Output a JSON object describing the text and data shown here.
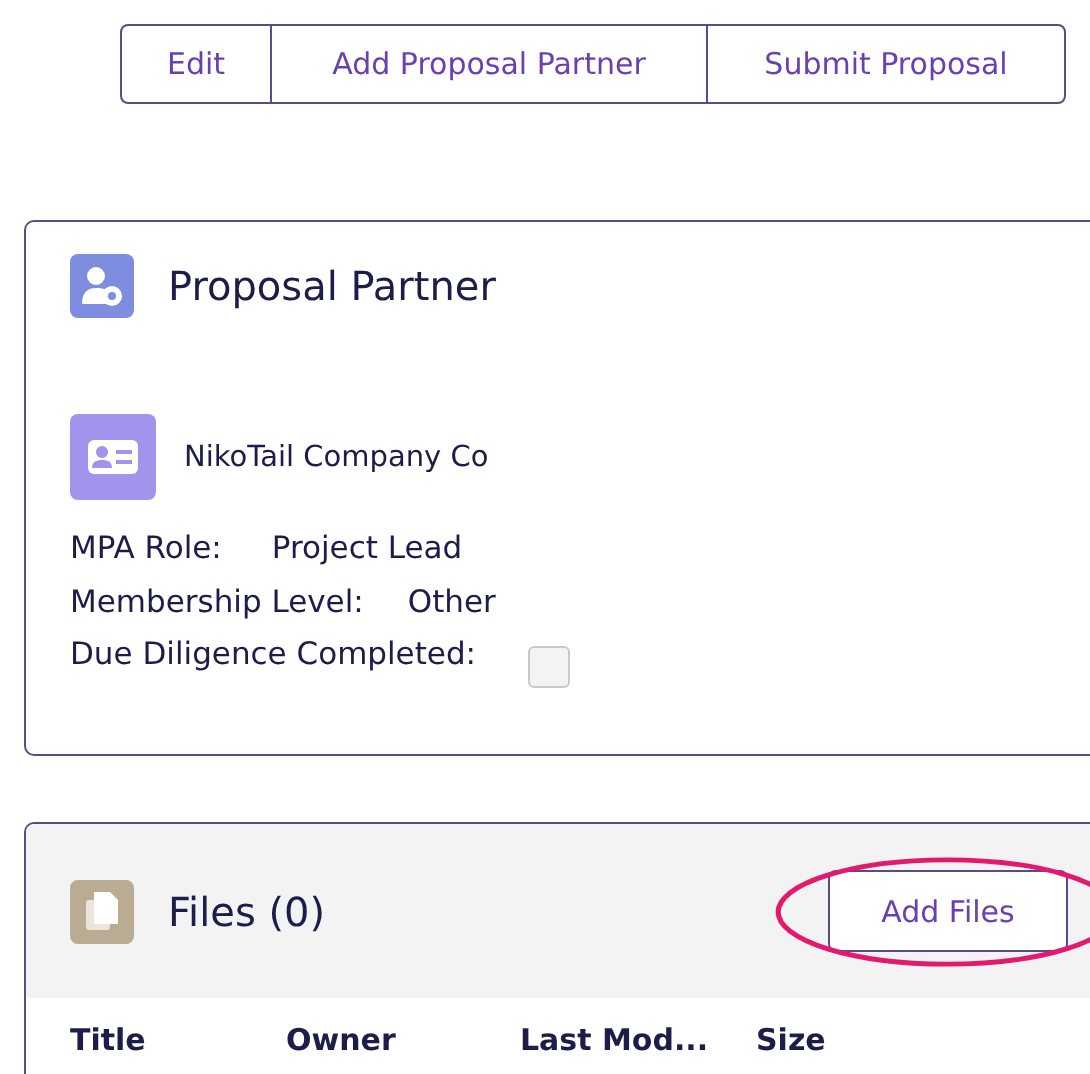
{
  "actions": [
    {
      "label": "Edit"
    },
    {
      "label": "Add Proposal Partner"
    },
    {
      "label": "Submit Proposal"
    }
  ],
  "partner_card": {
    "title": "Proposal Partner",
    "account": "NikoTail Company Co",
    "fields": [
      {
        "kind": "text",
        "label": "MPA Role:",
        "value": "Project Lead"
      },
      {
        "kind": "text",
        "label": "Membership Level:",
        "value": "Other"
      },
      {
        "kind": "checkbox",
        "label": "Due Diligence Completed:",
        "checked": false
      }
    ]
  },
  "files_card": {
    "title": "Files (0)",
    "button": "Add Files",
    "columns": [
      "Title",
      "Owner",
      "Last Mod...",
      "Size"
    ]
  }
}
